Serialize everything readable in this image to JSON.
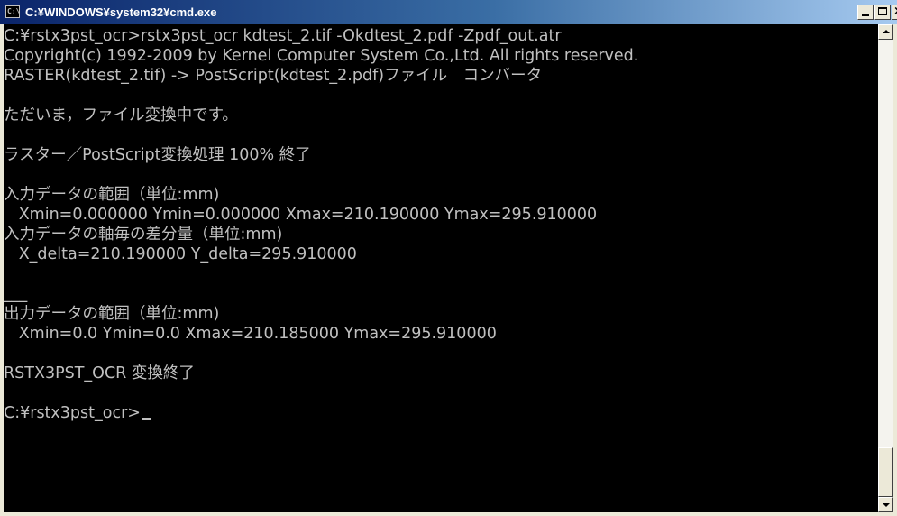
{
  "window": {
    "title": "C:¥WINDOWS¥system32¥cmd.exe",
    "icon": "console-window-icon",
    "icon_label": "C:\\",
    "buttons": {
      "minimize": "minimize-icon",
      "maximize": "maximize-icon",
      "close_label": "×"
    }
  },
  "console": {
    "lines": [
      "C:¥rstx3pst_ocr>rstx3pst_ocr kdtest_2.tif -Okdtest_2.pdf -Zpdf_out.atr",
      "Copyright(c) 1992-2009 by Kernel Computer System Co.,Ltd. All rights reserved.",
      "RASTER(kdtest_2.tif) -> PostScript(kdtest_2.pdf)ファイル　コンバータ",
      "",
      "ただいま，ファイル変換中です。",
      "",
      "ラスター／PostScript変換処理 100% 終了",
      "",
      "入力データの範囲（単位:mm)",
      "   Xmin=0.000000 Ymin=0.000000 Xmax=210.190000 Ymax=295.910000",
      "入力データの軸毎の差分量（単位:mm)",
      "   X_delta=210.190000 Y_delta=295.910000",
      "",
      "___",
      "出力データの範囲（単位:mm)",
      "   Xmin=0.0 Ymin=0.0 Xmax=210.185000 Ymax=295.910000",
      "",
      "RSTX3PST_OCR 変換終了",
      "",
      "C:¥rstx3pst_ocr>"
    ],
    "colors": {
      "background": "#000000",
      "foreground": "#C0C0C0"
    }
  },
  "scrollbar": {
    "up_icon": "scroll-up-arrow-icon",
    "down_icon": "scroll-down-arrow-icon"
  }
}
